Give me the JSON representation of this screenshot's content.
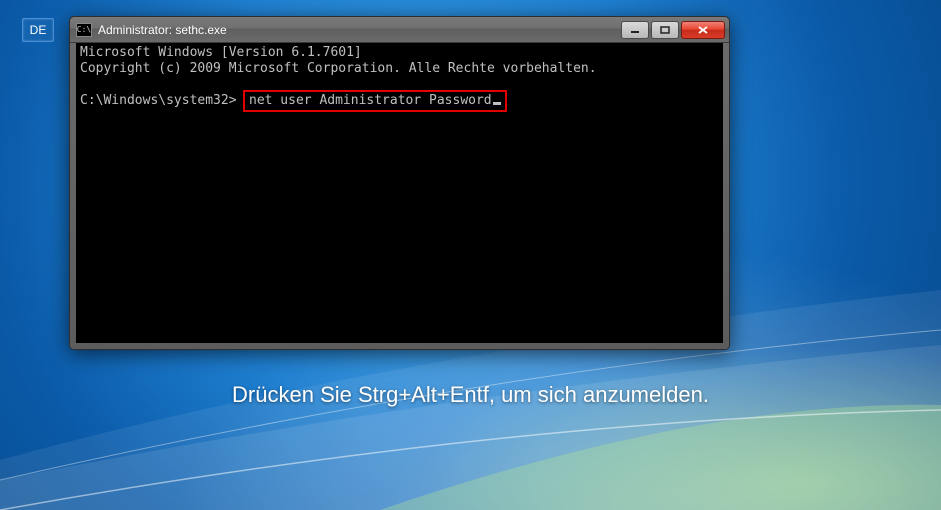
{
  "lang_badge": "DE",
  "login_prompt": "Drücken Sie Strg+Alt+Entf, um sich anzumelden.",
  "window": {
    "title": "Administrator: sethc.exe",
    "icon_glyph": "C:\\",
    "minimize_label": "Minimize",
    "maximize_label": "Maximize",
    "close_label": "Close"
  },
  "terminal": {
    "line1": "Microsoft Windows [Version 6.1.7601]",
    "line2": "Copyright (c) 2009 Microsoft Corporation. Alle Rechte vorbehalten.",
    "prompt_path": "C:\\Windows\\system32>",
    "command": "net user Administrator Password"
  }
}
